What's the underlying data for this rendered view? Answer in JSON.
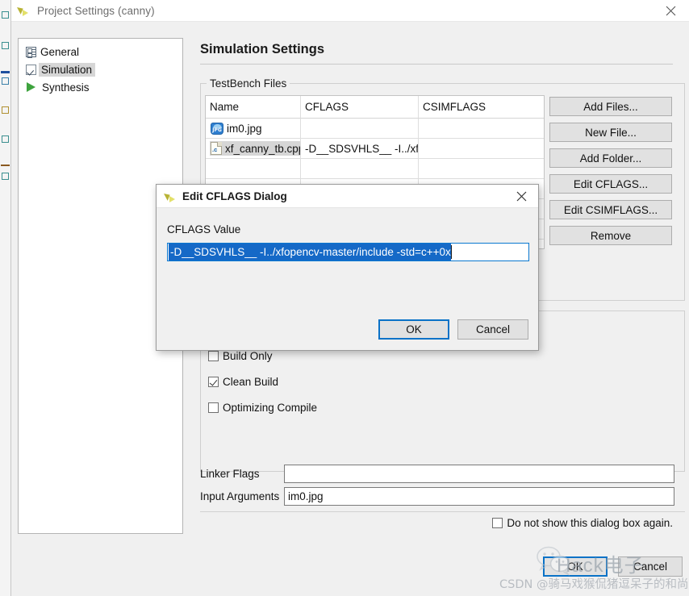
{
  "window": {
    "title": "Project Settings (canny)",
    "logo_icon": "vivado-logo-icon",
    "close_icon": "close-icon"
  },
  "sidebar": {
    "items": [
      {
        "label": "General",
        "icon": "list-page-icon",
        "selected": false
      },
      {
        "label": "Simulation",
        "icon": "checkbox-icon",
        "selected": true
      },
      {
        "label": "Synthesis",
        "icon": "play-triangle-icon",
        "selected": false
      }
    ]
  },
  "main": {
    "page_title": "Simulation Settings",
    "testbench_group": {
      "legend": "TestBench Files",
      "columns": [
        "Name",
        "CFLAGS",
        "CSIMFLAGS"
      ],
      "rows": [
        {
          "name": "im0.jpg",
          "icon": "jpg-file-icon",
          "cflags": "",
          "csimflags": "",
          "selected": false
        },
        {
          "name": "xf_canny_tb.cpp",
          "icon": "c-file-icon",
          "cflags": "-D__SDSVHLS__  -I../xf...",
          "csimflags": "",
          "selected": true
        },
        {
          "name": "",
          "icon": "",
          "cflags": "",
          "csimflags": "",
          "selected": false
        },
        {
          "name": "",
          "icon": "",
          "cflags": "",
          "csimflags": "",
          "selected": false
        },
        {
          "name": "",
          "icon": "",
          "cflags": "",
          "csimflags": "",
          "selected": false
        },
        {
          "name": "",
          "icon": "",
          "cflags": "",
          "csimflags": "",
          "selected": false
        }
      ],
      "buttons": [
        "Add Files...",
        "New File...",
        "Add Folder...",
        "Edit CFLAGS...",
        "Edit CSIMFLAGS...",
        "Remove"
      ]
    },
    "options": {
      "checkboxes": [
        {
          "label": "Build Only",
          "checked": false
        },
        {
          "label": "Clean Build",
          "checked": true
        },
        {
          "label": "Optimizing Compile",
          "checked": false
        }
      ]
    },
    "fields": [
      {
        "label": "Linker Flags",
        "value": "",
        "placeholder": ""
      },
      {
        "label": "Input Arguments",
        "value": "im0.jpg",
        "placeholder": ""
      }
    ],
    "dont_show_again": {
      "label": "Do not show this dialog box again.",
      "checked": false
    },
    "footer_buttons": {
      "ok": "OK",
      "cancel": "Cancel"
    }
  },
  "dialog": {
    "title": "Edit CFLAGS Dialog",
    "logo_icon": "vivado-logo-icon",
    "close_icon": "close-icon",
    "field_label": "CFLAGS Value",
    "field_value": "-D__SDSVHLS__  -I../xfopencv-master/include -std=c++0x",
    "field_selected": true,
    "ok": "OK",
    "cancel": "Cancel"
  },
  "watermark": {
    "brand": "Hack电子",
    "csdn": "CSDN @骑马戏猴侃猪逗呆子的和尚",
    "logo_icon": "wechat-icon"
  },
  "colors": {
    "accent_blue": "#0a72c7",
    "selection_blue": "#1569c7",
    "window_bg": "#f0f0f0",
    "panel_white": "#ffffff",
    "button_face": "#e1e1e1",
    "row_selected": "#d6d6d6",
    "green_play": "#3ea33e"
  }
}
